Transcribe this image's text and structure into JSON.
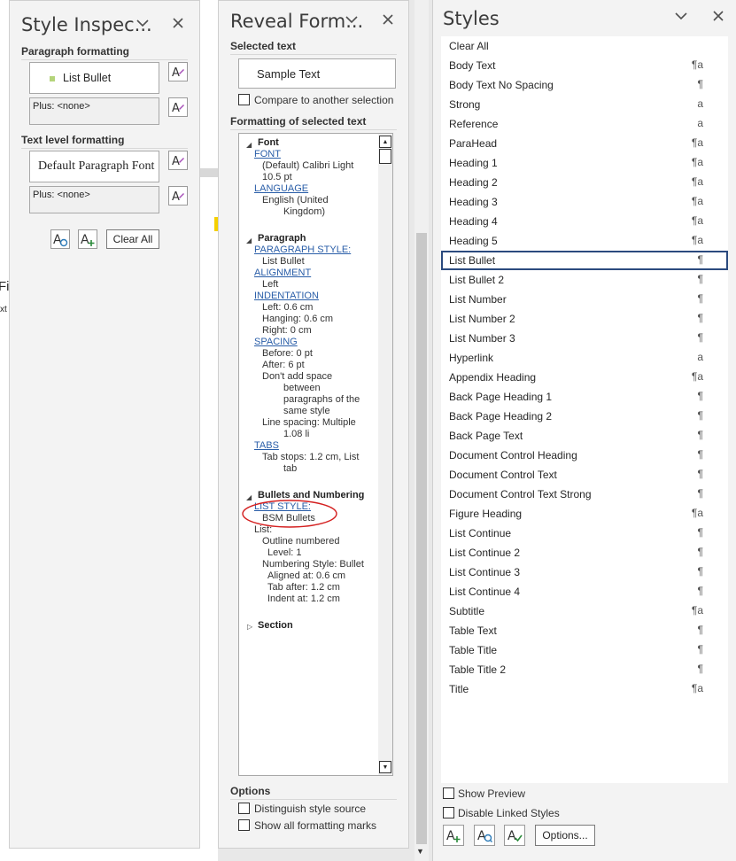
{
  "style_inspector": {
    "title": "Style Inspec...",
    "paragraph_heading": "Paragraph formatting",
    "paragraph_style": "List Bullet",
    "paragraph_plus": "Plus: <none>",
    "text_heading": "Text level formatting",
    "text_style": "Default Paragraph Font",
    "text_plus": "Plus: <none>",
    "clear_all": "Clear All"
  },
  "document_fragment": {
    "line1": "Fi",
    "line2": "xt"
  },
  "reveal_formatting": {
    "title": "Reveal Form...",
    "selected_text_heading": "Selected text",
    "sample_text": "Sample Text",
    "compare_label": "Compare to another selection",
    "formatting_heading": "Formatting of selected text",
    "options_heading": "Options",
    "distinguish_label": "Distinguish style source",
    "show_marks_label": "Show all formatting marks",
    "tree": {
      "font": {
        "header": "Font",
        "font_link": "FONT",
        "font_value1": "(Default) Calibri Light",
        "font_value2": "10.5 pt",
        "language_link": "LANGUAGE",
        "language_value1": "English (United",
        "language_value2": "Kingdom)"
      },
      "paragraph": {
        "header": "Paragraph",
        "style_link": "PARAGRAPH STYLE:",
        "style_value": "List Bullet",
        "alignment_link": "ALIGNMENT",
        "alignment_value": "Left",
        "indentation_link": "INDENTATION",
        "indent_left": "Left:  0.6 cm",
        "indent_hanging": "Hanging:  0.6 cm",
        "indent_right": "Right:  0 cm",
        "spacing_link": "SPACING",
        "spacing_before": "Before:  0 pt",
        "spacing_after": "After:  6 pt",
        "spacing_dont1": "Don't add space",
        "spacing_dont2": "between",
        "spacing_dont3": "paragraphs of the",
        "spacing_dont4": "same style",
        "line_spacing1": "Line spacing:  Multiple",
        "line_spacing2": "1.08 li",
        "tabs_link": "TABS",
        "tab_stops1": "Tab stops:  1.2 cm, List",
        "tab_stops2": "tab"
      },
      "bullets": {
        "header": "Bullets and Numbering",
        "list_style_link": "LIST STYLE:",
        "list_style_value": "BSM Bullets",
        "list_label": "List:",
        "outline": "Outline numbered",
        "level": "Level: 1",
        "numbering_style": "Numbering Style:  Bullet",
        "aligned": "Aligned at:  0.6 cm",
        "tab_after": "Tab after:  1.2 cm",
        "indent_at": "Indent at:  1.2 cm"
      },
      "section": {
        "header": "Section"
      }
    }
  },
  "styles_pane": {
    "title": "Styles",
    "items": [
      {
        "name": "Clear All",
        "sym": ""
      },
      {
        "name": "Body Text",
        "sym": "¶a"
      },
      {
        "name": "Body Text No Spacing",
        "sym": "¶"
      },
      {
        "name": "Strong",
        "sym": "a"
      },
      {
        "name": "Reference",
        "sym": "a"
      },
      {
        "name": "ParaHead",
        "sym": "¶a"
      },
      {
        "name": "Heading 1",
        "sym": "¶a"
      },
      {
        "name": "Heading 2",
        "sym": "¶a"
      },
      {
        "name": "Heading 3",
        "sym": "¶a"
      },
      {
        "name": "Heading 4",
        "sym": "¶a"
      },
      {
        "name": "Heading 5",
        "sym": "¶a"
      },
      {
        "name": "List Bullet",
        "sym": "¶",
        "selected": true
      },
      {
        "name": "List Bullet 2",
        "sym": "¶"
      },
      {
        "name": "List Number",
        "sym": "¶"
      },
      {
        "name": "List Number 2",
        "sym": "¶"
      },
      {
        "name": "List Number 3",
        "sym": "¶"
      },
      {
        "name": "Hyperlink",
        "sym": "a"
      },
      {
        "name": "Appendix Heading",
        "sym": "¶a"
      },
      {
        "name": "Back Page Heading 1",
        "sym": "¶"
      },
      {
        "name": "Back Page Heading 2",
        "sym": "¶"
      },
      {
        "name": "Back Page Text",
        "sym": "¶"
      },
      {
        "name": "Document Control Heading",
        "sym": "¶"
      },
      {
        "name": "Document Control Text",
        "sym": "¶"
      },
      {
        "name": "Document Control Text Strong",
        "sym": "¶"
      },
      {
        "name": "Figure Heading",
        "sym": "¶a"
      },
      {
        "name": "List Continue",
        "sym": "¶"
      },
      {
        "name": "List Continue 2",
        "sym": "¶"
      },
      {
        "name": "List Continue 3",
        "sym": "¶"
      },
      {
        "name": "List Continue 4",
        "sym": "¶"
      },
      {
        "name": "Subtitle",
        "sym": "¶a"
      },
      {
        "name": "Table Text",
        "sym": "¶"
      },
      {
        "name": "Table Title",
        "sym": "¶"
      },
      {
        "name": "Table Title 2",
        "sym": "¶"
      },
      {
        "name": "Title",
        "sym": "¶a"
      }
    ],
    "show_preview_label": "Show Preview",
    "disable_linked_label": "Disable Linked Styles",
    "options_label": "Options..."
  },
  "colors": {
    "link": "#2a5ea8",
    "selection_border": "#2b4a7e",
    "annotation_circle": "#d42020",
    "bullet_marker": "#b4d47a"
  }
}
